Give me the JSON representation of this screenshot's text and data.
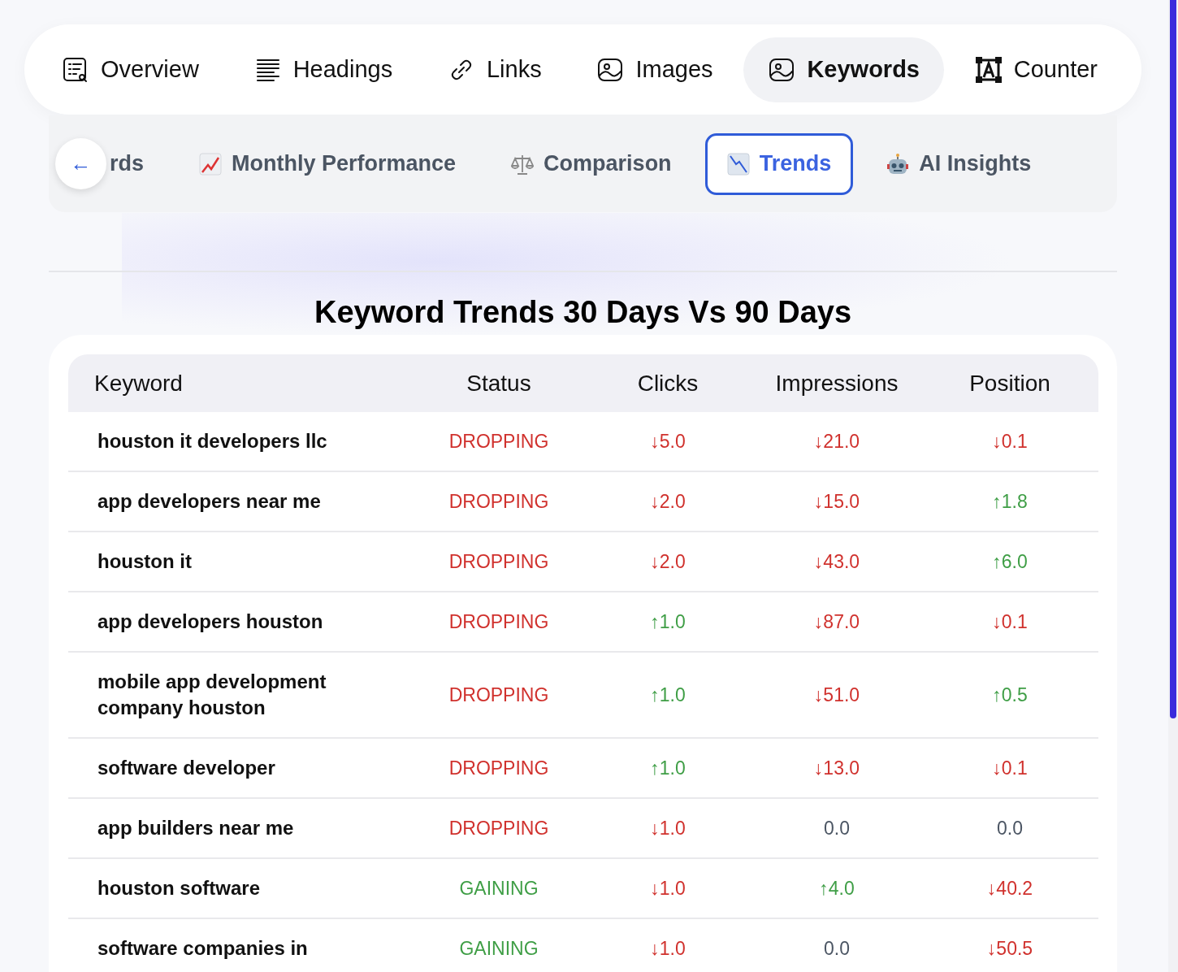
{
  "nav_tabs": [
    {
      "label": "Overview",
      "selected": false
    },
    {
      "label": "Headings",
      "selected": false
    },
    {
      "label": "Links",
      "selected": false
    },
    {
      "label": "Images",
      "selected": false
    },
    {
      "label": "Keywords",
      "selected": true
    },
    {
      "label": "Counter",
      "selected": false
    }
  ],
  "sub_tabs": [
    {
      "label": "rds",
      "selected": false
    },
    {
      "label": "Monthly Performance",
      "selected": false
    },
    {
      "label": "Comparison",
      "selected": false
    },
    {
      "label": "Trends",
      "selected": true
    },
    {
      "label": "AI Insights",
      "selected": false
    }
  ],
  "back_button": {
    "label": "←"
  },
  "title": "Keyword Trends 30 Days Vs 90 Days",
  "table": {
    "columns": [
      "Keyword",
      "Status",
      "Clicks",
      "Impressions",
      "Position"
    ],
    "rows": [
      {
        "keyword": "houston it developers llc",
        "status": {
          "text": "DROPPING",
          "kind": "dropping"
        },
        "values": [
          {
            "text": "↓5.0",
            "kind": "down"
          },
          {
            "text": "↓21.0",
            "kind": "down"
          },
          {
            "text": "↓0.1",
            "kind": "down"
          }
        ]
      },
      {
        "keyword": "app developers near me",
        "status": {
          "text": "DROPPING",
          "kind": "dropping"
        },
        "values": [
          {
            "text": "↓2.0",
            "kind": "down"
          },
          {
            "text": "↓15.0",
            "kind": "down"
          },
          {
            "text": "↑1.8",
            "kind": "up"
          }
        ]
      },
      {
        "keyword": "houston it",
        "status": {
          "text": "DROPPING",
          "kind": "dropping"
        },
        "values": [
          {
            "text": "↓2.0",
            "kind": "down"
          },
          {
            "text": "↓43.0",
            "kind": "down"
          },
          {
            "text": "↑6.0",
            "kind": "up"
          }
        ]
      },
      {
        "keyword": "app developers houston",
        "status": {
          "text": "DROPPING",
          "kind": "dropping"
        },
        "values": [
          {
            "text": "↑1.0",
            "kind": "up"
          },
          {
            "text": "↓87.0",
            "kind": "down"
          },
          {
            "text": "↓0.1",
            "kind": "down"
          }
        ]
      },
      {
        "keyword": "mobile app development company houston",
        "status": {
          "text": "DROPPING",
          "kind": "dropping"
        },
        "values": [
          {
            "text": "↑1.0",
            "kind": "up"
          },
          {
            "text": "↓51.0",
            "kind": "down"
          },
          {
            "text": "↑0.5",
            "kind": "up"
          }
        ]
      },
      {
        "keyword": "software developer",
        "status": {
          "text": "DROPPING",
          "kind": "dropping"
        },
        "values": [
          {
            "text": "↑1.0",
            "kind": "up"
          },
          {
            "text": "↓13.0",
            "kind": "down"
          },
          {
            "text": "↓0.1",
            "kind": "down"
          }
        ]
      },
      {
        "keyword": "app builders near me",
        "status": {
          "text": "DROPPING",
          "kind": "dropping"
        },
        "values": [
          {
            "text": "↓1.0",
            "kind": "down"
          },
          {
            "text": "0.0",
            "kind": "flat"
          },
          {
            "text": "0.0",
            "kind": "flat"
          }
        ]
      },
      {
        "keyword": "houston software",
        "status": {
          "text": "GAINING",
          "kind": "gaining"
        },
        "values": [
          {
            "text": "↓1.0",
            "kind": "down"
          },
          {
            "text": "↑4.0",
            "kind": "up"
          },
          {
            "text": "↓40.2",
            "kind": "down"
          }
        ]
      },
      {
        "keyword": "software companies in",
        "status": {
          "text": "GAINING",
          "kind": "gaining"
        },
        "values": [
          {
            "text": "↓1.0",
            "kind": "down"
          },
          {
            "text": "0.0",
            "kind": "flat"
          },
          {
            "text": "↓50.5",
            "kind": "down"
          }
        ]
      }
    ]
  }
}
